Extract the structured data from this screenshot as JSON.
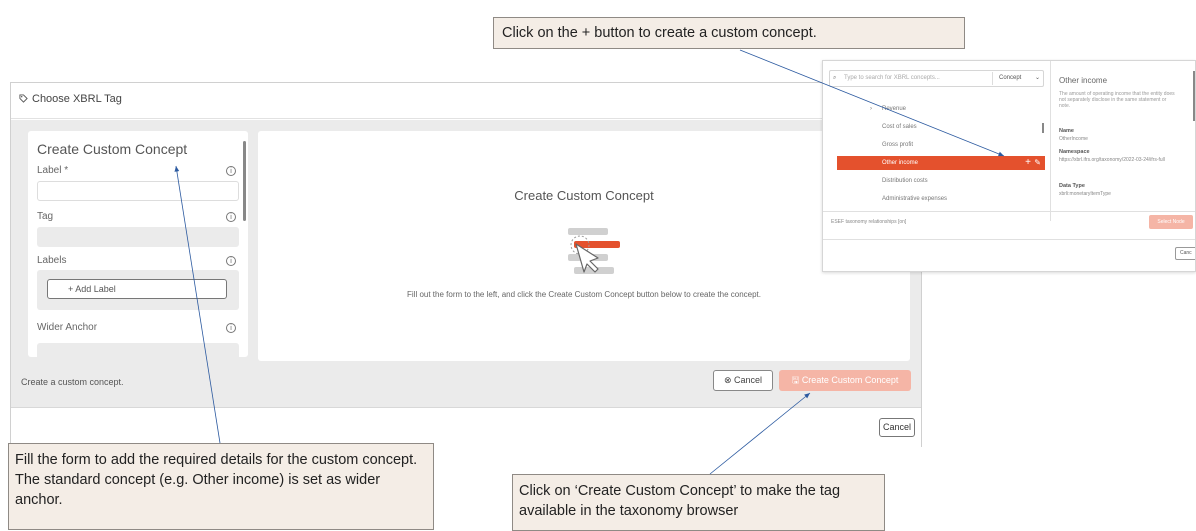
{
  "dialog": {
    "title": "Choose XBRL Tag",
    "footer_cancel": "Cancel"
  },
  "form": {
    "title": "Create Custom Concept",
    "label_field": "Label *",
    "tag_field": "Tag",
    "labels_field": "Labels",
    "add_label_button": "+ Add Label",
    "wider_anchor_field": "Wider Anchor",
    "info_glyph": "i"
  },
  "info_panel": {
    "title": "Create Custom Concept",
    "instruction": "Fill out the form to the left, and click the Create Custom Concept button below to create the concept."
  },
  "status": "Create a custom concept.",
  "buttons": {
    "cancel": "Cancel",
    "create": "Create Custom Concept"
  },
  "taxonomy_browser": {
    "search_placeholder": "Type to search for XBRL concepts...",
    "filter_select": "Concept",
    "tree_items": [
      {
        "label": "Revenue",
        "active": false
      },
      {
        "label": "Cost of sales",
        "active": false
      },
      {
        "label": "Gross profit",
        "active": false
      },
      {
        "label": "Other income",
        "active": true
      },
      {
        "label": "Distribution costs",
        "active": false
      },
      {
        "label": "Administrative expenses",
        "active": false
      }
    ],
    "plus": "+",
    "detail": {
      "title": "Other income",
      "description": "The amount of operating income that the entity does not separately disclose in the same statement or note.",
      "name_key": "Name",
      "name_value": "OtherIncome",
      "namespace_key": "Namespace",
      "namespace_value": "https://xbrl.ifrs.org/taxonomy/2022-03-24/ifrs-full",
      "datatype_key": "Data Type",
      "datatype_value": "xbrli:monetaryItemType"
    },
    "footer_link": "ESEF taxonomy relationships [on]",
    "select_button": "Select Node",
    "cancel_button": "Canc"
  },
  "callouts": {
    "top": "Click on the + button to create a custom concept.",
    "left": "Fill the form to add the required details for the custom concept. The standard concept (e.g. Other income) is set as wider anchor.",
    "right": "Click on ‘Create Custom Concept’ to make the tag available in the taxonomy browser"
  },
  "colors": {
    "accent": "#e4512d",
    "accent_disabled": "#f5b5a6",
    "callout_bg": "#f4ede6",
    "arrow": "#2c5aa0"
  }
}
